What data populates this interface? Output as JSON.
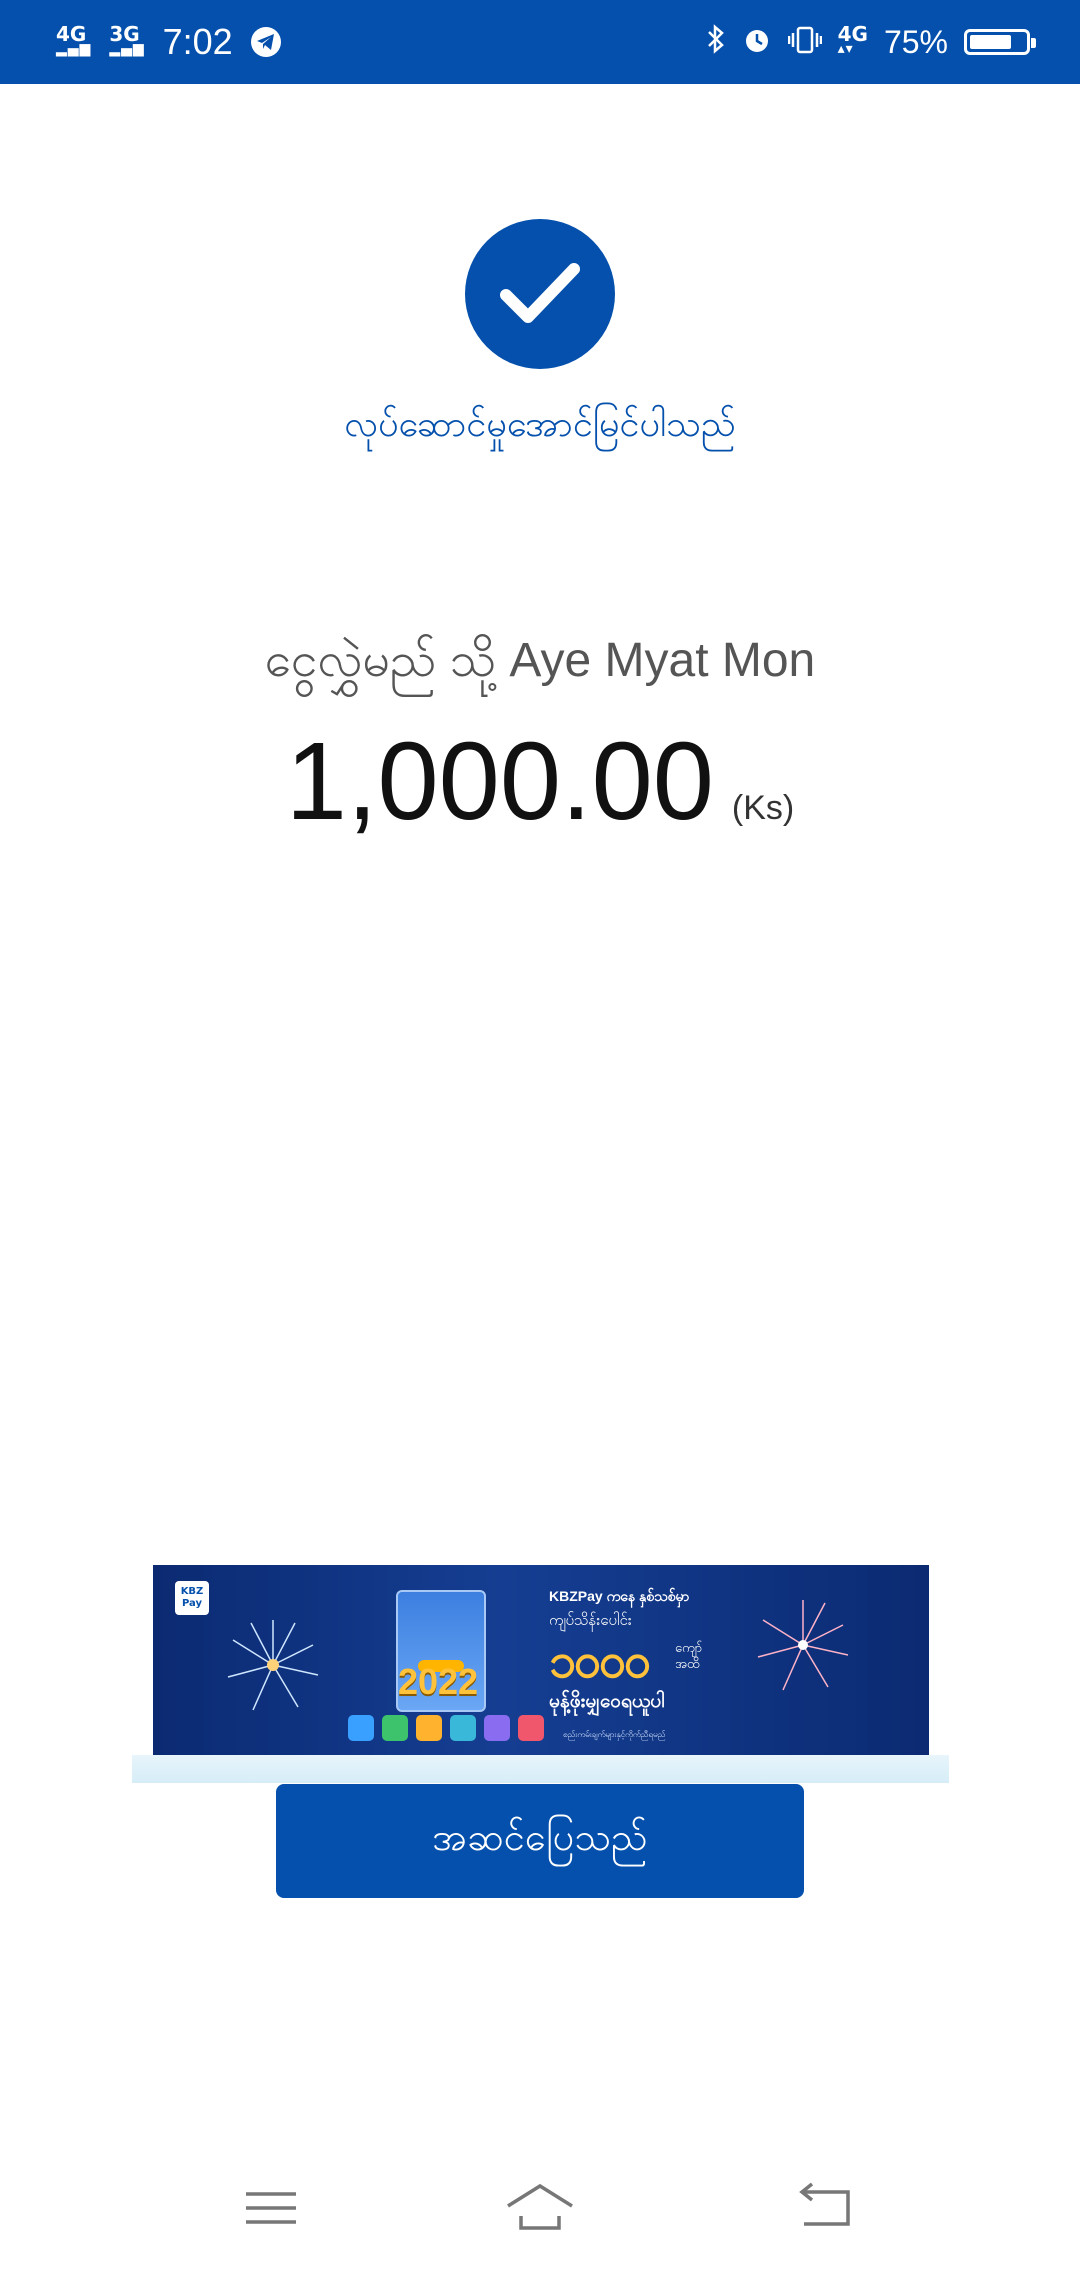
{
  "status_bar": {
    "network_1": "4G",
    "network_2": "3G",
    "time": "7:02",
    "network_3": "4G",
    "battery_percent": "75%",
    "battery_level": 0.75,
    "icons": [
      "telegram-icon",
      "bluetooth-icon",
      "alarm-icon",
      "vibrate-icon",
      "signal-icon",
      "battery-icon"
    ]
  },
  "result": {
    "status_text": "လုပ်ဆောင်မှုအောင်မြင်ပါသည်",
    "recipient_text": "ငွေလွှဲမည် သို့ Aye Myat Mon",
    "amount": "1,000.00",
    "currency": "(Ks)"
  },
  "banner": {
    "logo": "KBZ Pay",
    "title": "KBZPay ကနေ နှစ်သစ်မှာ",
    "line": "ကျပ်သိန်းပေါင်း",
    "big_number": "၁၀၀၀",
    "unit_line1": "ကျော်",
    "unit_line2": "အထိ",
    "sub": "မုန့်ဖိုးမျှဝေရယူပါ",
    "year": "2022",
    "fine_print": "စည်းကမ်းချက်များနှင့်ကိုက်ညီရမည်"
  },
  "actions": {
    "done_label": "အဆင်ပြေသည်"
  },
  "nav_bar": {
    "icons": [
      "menu-icon",
      "home-icon",
      "back-icon"
    ]
  },
  "colors": {
    "brand_blue": "#0450ac",
    "banner_gold": "#ffc23a"
  }
}
